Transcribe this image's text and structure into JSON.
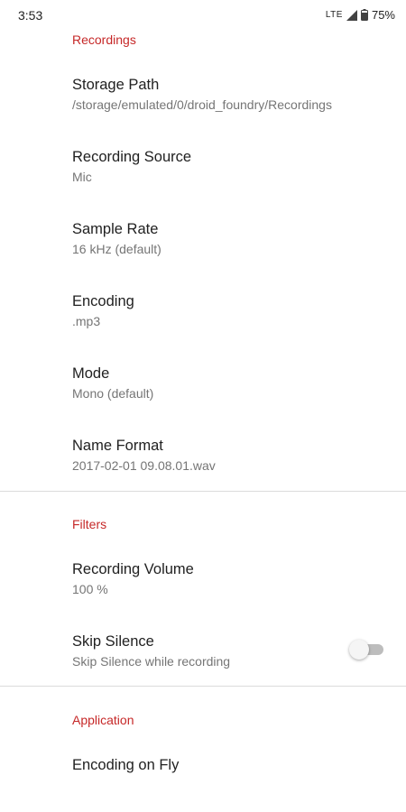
{
  "status_bar": {
    "time": "3:53",
    "network": "LTE",
    "battery": "75%"
  },
  "sections": {
    "recordings": "Recordings",
    "filters": "Filters",
    "application": "Application"
  },
  "prefs": {
    "storage_path": {
      "title": "Storage Path",
      "summary": "/storage/emulated/0/droid_foundry/Recordings"
    },
    "recording_source": {
      "title": "Recording Source",
      "summary": "Mic"
    },
    "sample_rate": {
      "title": "Sample Rate",
      "summary": "16 kHz (default)"
    },
    "encoding": {
      "title": "Encoding",
      "summary": ".mp3"
    },
    "mode": {
      "title": "Mode",
      "summary": "Mono (default)"
    },
    "name_format": {
      "title": "Name Format",
      "summary": "2017-02-01 09.08.01.wav"
    },
    "recording_volume": {
      "title": "Recording Volume",
      "summary": "100 %"
    },
    "skip_silence": {
      "title": "Skip Silence",
      "summary": "Skip Silence while recording",
      "enabled": false
    },
    "encoding_on_fly": {
      "title": "Encoding on Fly"
    }
  },
  "colors": {
    "accent": "#c62828",
    "divider": "#dcdcdc"
  }
}
